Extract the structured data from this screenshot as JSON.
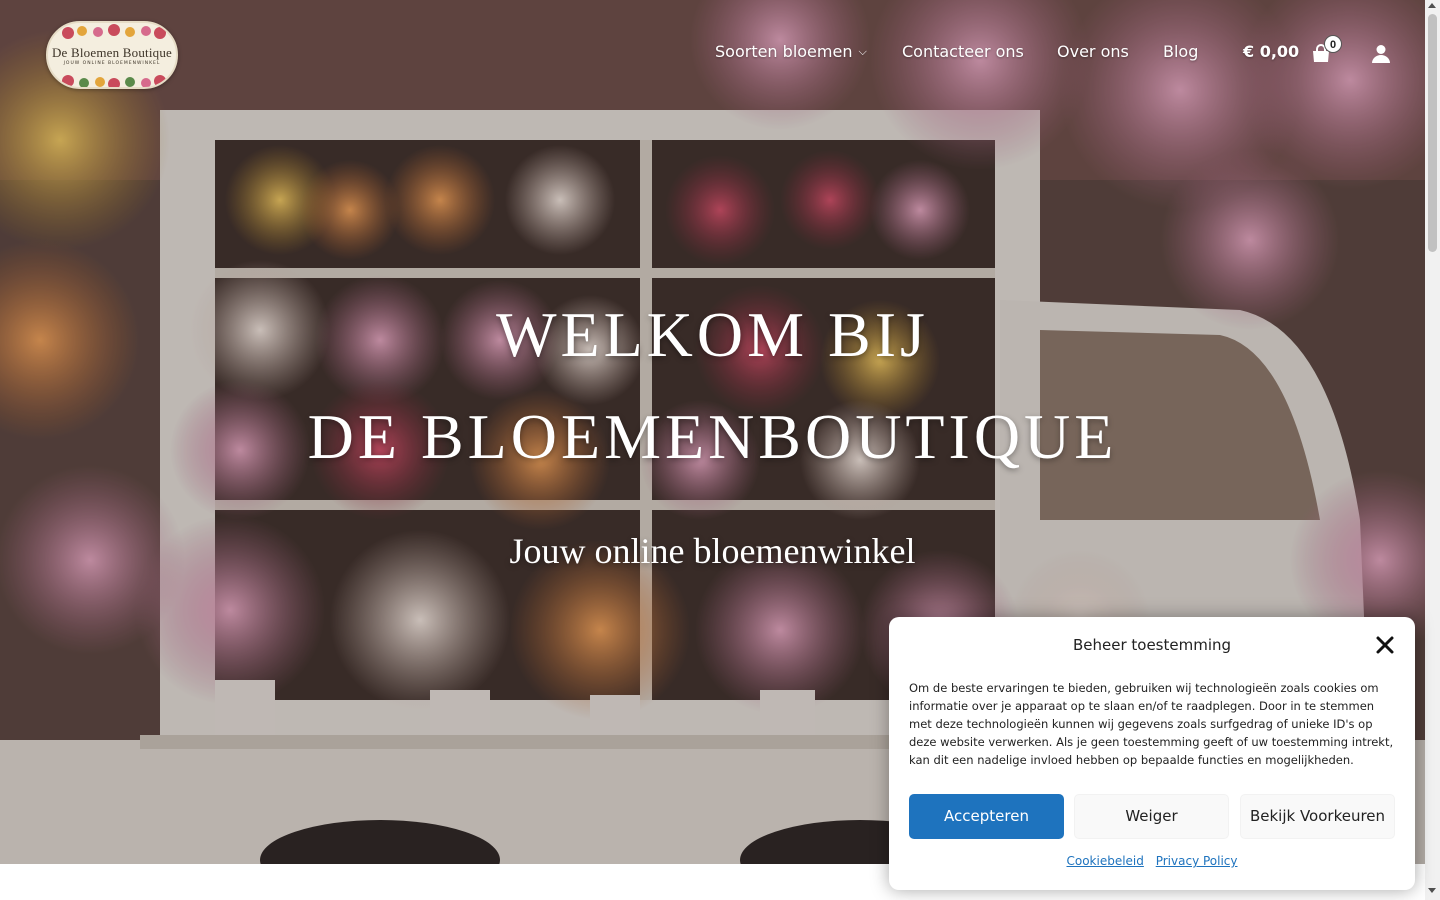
{
  "header": {
    "logo": {
      "title": "De Bloemen Boutique",
      "tagline": "JOUW ONLINE BLOEMENWINKEL"
    },
    "nav": [
      {
        "label": "Soorten bloemen",
        "has_dropdown": true
      },
      {
        "label": "Contacteer ons"
      },
      {
        "label": "Over ons"
      },
      {
        "label": "Blog"
      }
    ],
    "cart": {
      "total": "€ 0,00",
      "count": "0",
      "icon": "shopping-bag-icon"
    },
    "account": {
      "icon": "user-icon"
    }
  },
  "hero": {
    "title_line1": "WELKOM BIJ",
    "title_line2": "DE BLOEMENBOUTIQUE",
    "subtitle": "Jouw online bloemenwinkel"
  },
  "cookie_banner": {
    "title": "Beheer toestemming",
    "text": "Om de beste ervaringen te bieden, gebruiken wij technologieën zoals cookies om informatie over je apparaat op te slaan en/of te raadplegen. Door in te stemmen met deze technologieën kunnen wij gegevens zoals surfgedrag of unieke ID's op deze website verwerken. Als je geen toestemming geeft of uw toestemming intrekt, kan dit een nadelige invloed hebben op bepaalde functies en mogelijkheden.",
    "buttons": {
      "accept": "Accepteren",
      "deny": "Weiger",
      "preferences": "Bekijk Voorkeuren"
    },
    "links": {
      "cookie_policy": "Cookiebeleid",
      "privacy_policy": "Privacy Policy"
    }
  },
  "colors": {
    "accent": "#1e73be",
    "text_on_hero": "#ffffff"
  }
}
